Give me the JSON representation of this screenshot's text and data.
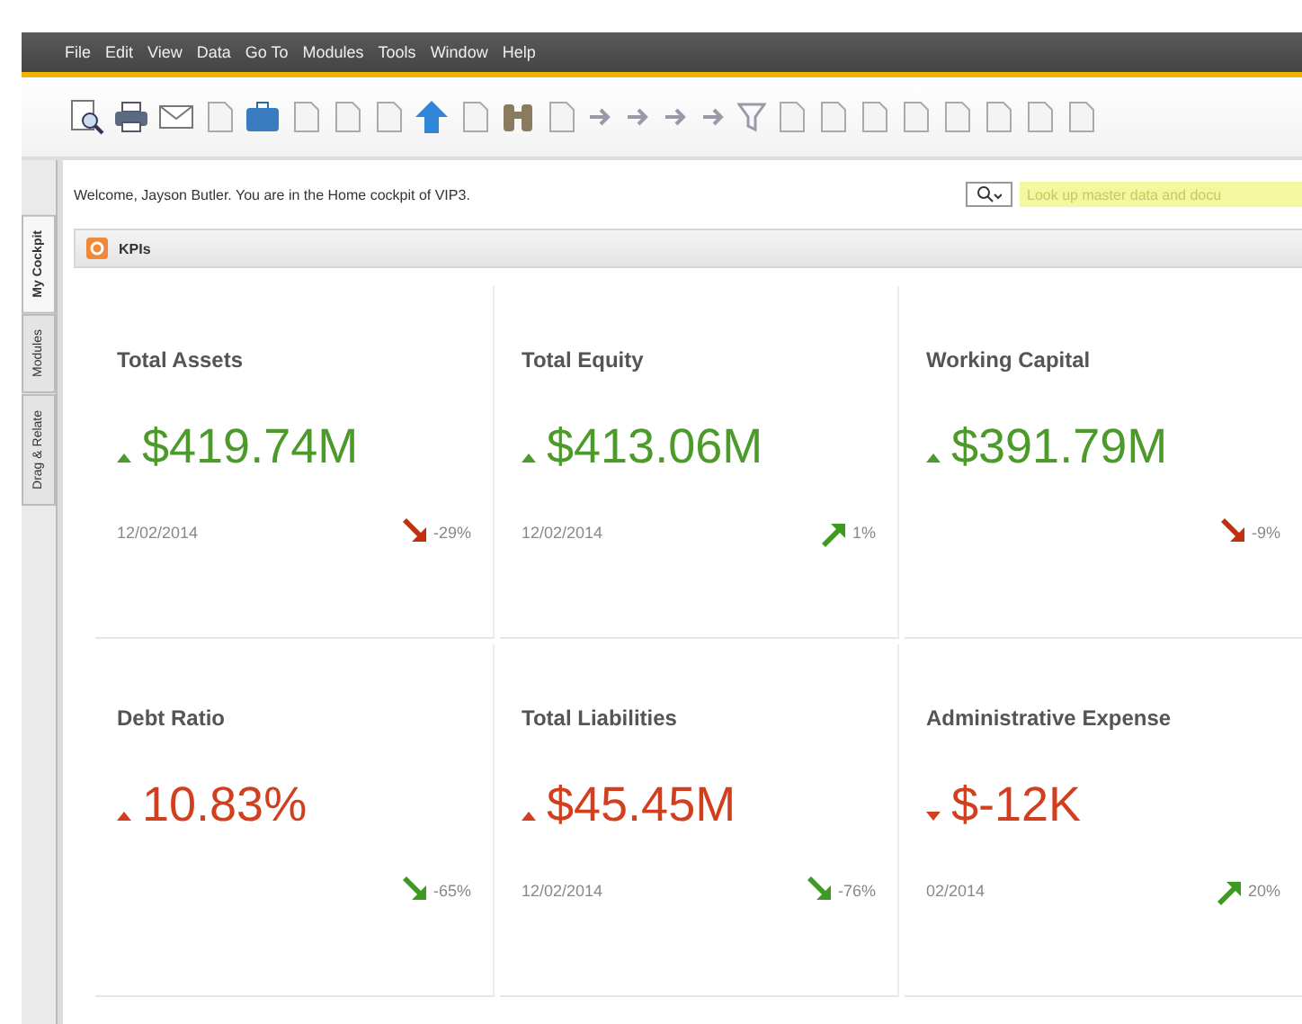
{
  "menu": [
    "File",
    "Edit",
    "View",
    "Data",
    "Go To",
    "Modules",
    "Tools",
    "Window",
    "Help"
  ],
  "side_tabs": [
    {
      "label": "My Cockpit",
      "selected": true
    },
    {
      "label": "Modules",
      "selected": false
    },
    {
      "label": "Drag & Relate",
      "selected": false
    }
  ],
  "welcome": "Welcome, Jayson Butler. You are in the Home cockpit of VIP3.",
  "search": {
    "placeholder": "Look up master data and docu"
  },
  "panel": {
    "title": "KPIs"
  },
  "kpis": [
    {
      "title": "Total Assets",
      "value": "$419.74M",
      "good": true,
      "rising": true,
      "date": "12/02/2014",
      "trend_rising": false,
      "trend_good": false,
      "change": "-29%"
    },
    {
      "title": "Total Equity",
      "value": "$413.06M",
      "good": true,
      "rising": true,
      "date": "12/02/2014",
      "trend_rising": true,
      "trend_good": true,
      "change": "1%"
    },
    {
      "title": "Working Capital",
      "value": "$391.79M",
      "good": true,
      "rising": true,
      "trend_rising": false,
      "trend_good": false,
      "change": "-9%"
    },
    {
      "title": "Debt Ratio",
      "value": "10.83%",
      "good": false,
      "rising": true,
      "trend_rising": false,
      "trend_good": true,
      "change": "-65%"
    },
    {
      "title": "Total Liabilities",
      "value": "$45.45M",
      "good": false,
      "rising": true,
      "date": "12/02/2014",
      "trend_rising": false,
      "trend_good": true,
      "change": "-76%"
    },
    {
      "title": "Administrative Expense",
      "value": "$-12K",
      "good": false,
      "rising": false,
      "date": "02/2014",
      "trend_rising": true,
      "trend_good": true,
      "change": "20%"
    }
  ]
}
